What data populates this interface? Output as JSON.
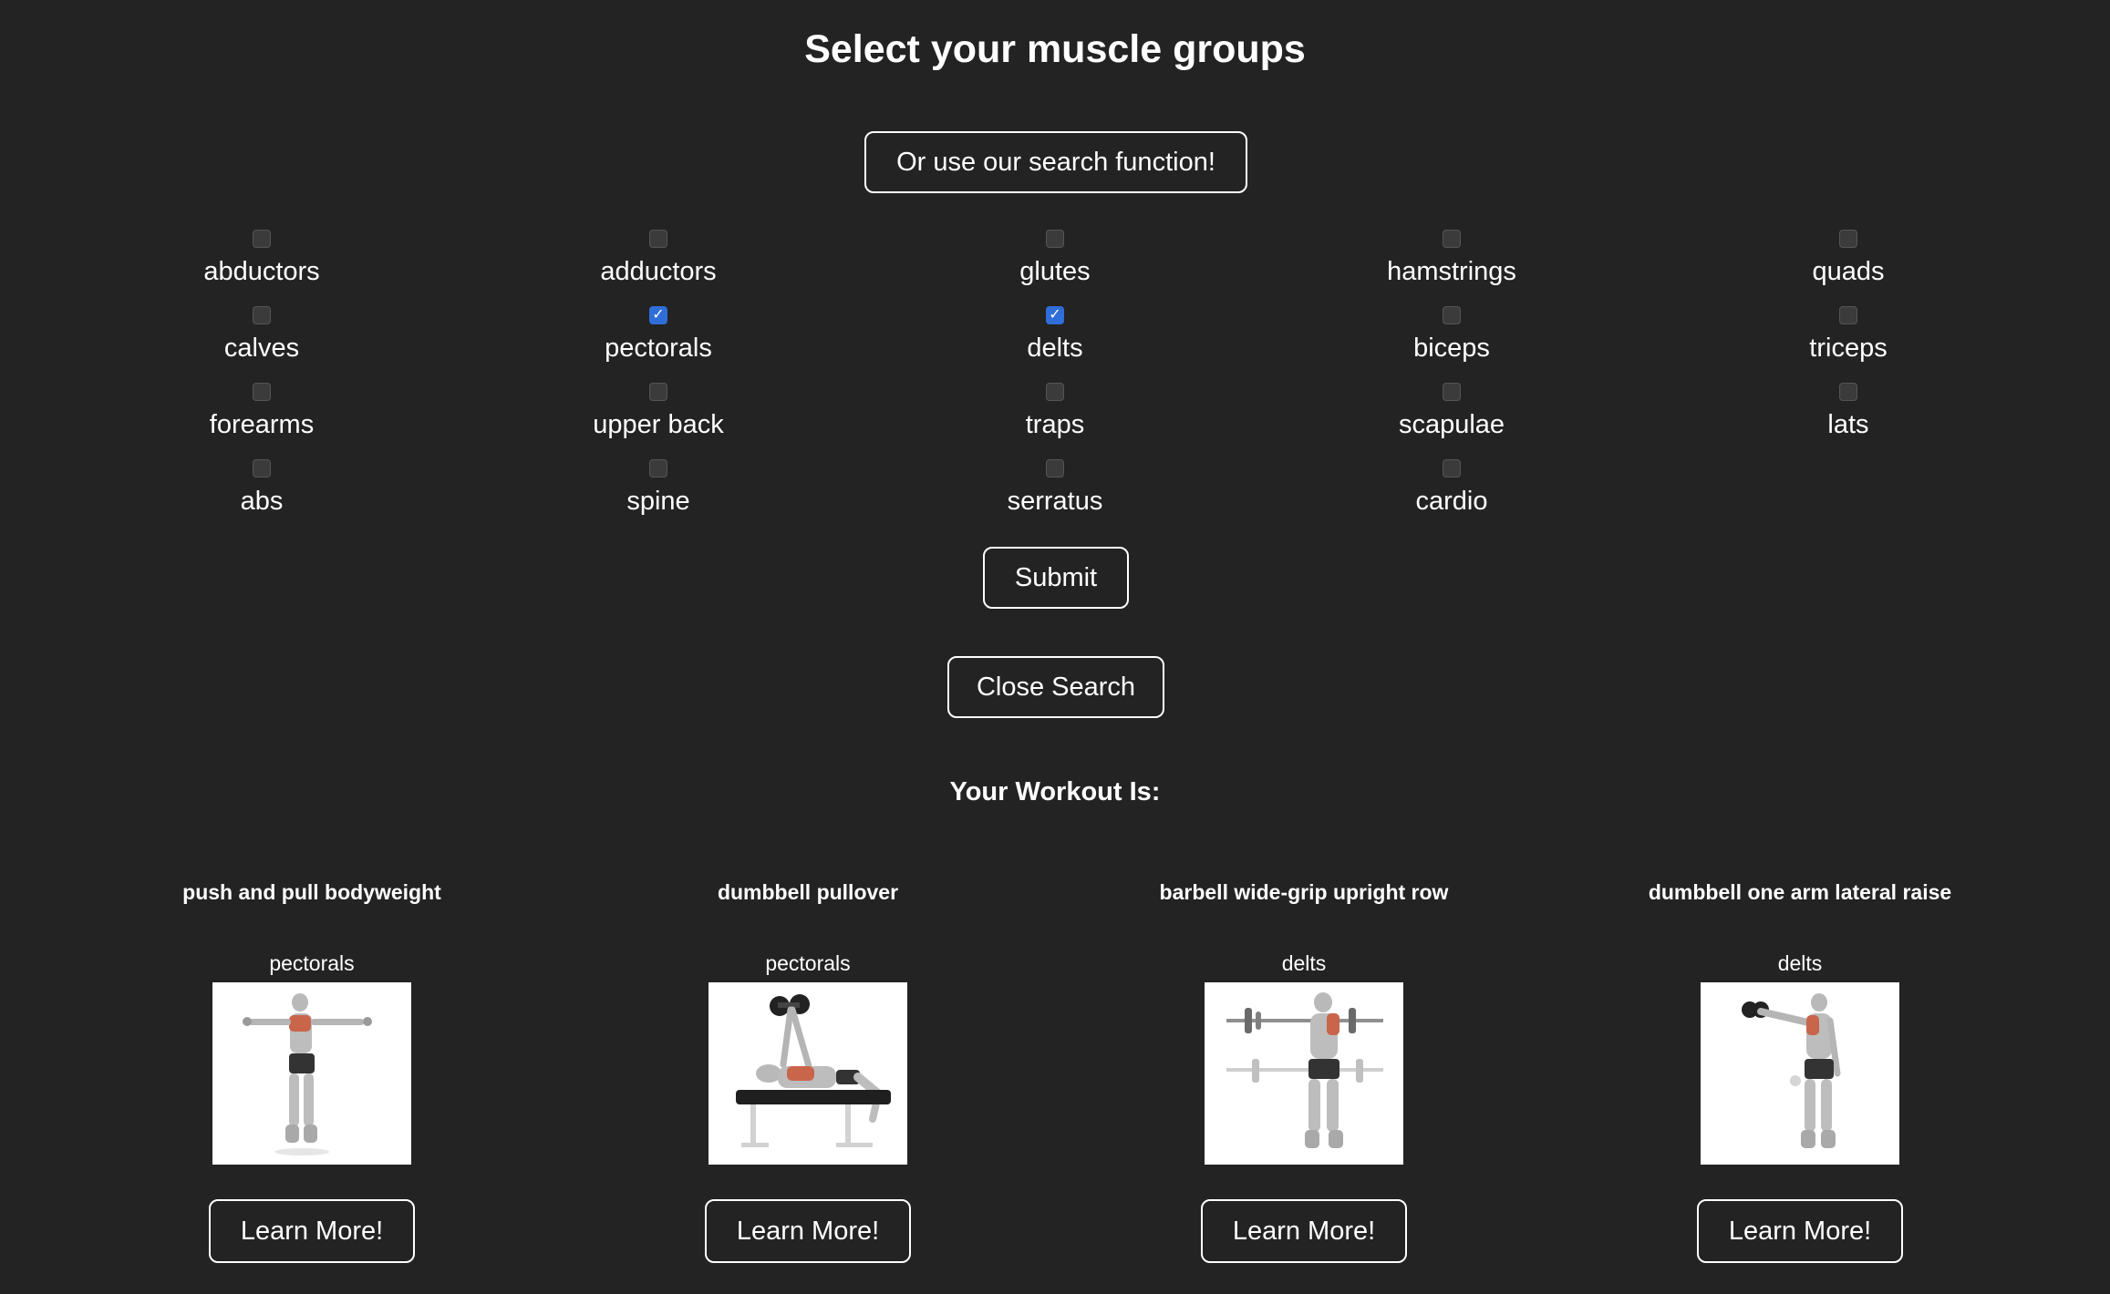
{
  "page": {
    "title": "Select your muscle groups",
    "search_button": "Or use our search function!",
    "submit_button": "Submit",
    "close_button": "Close Search",
    "workout_heading": "Your Workout Is:"
  },
  "muscles": [
    {
      "label": "abductors",
      "checked": false
    },
    {
      "label": "adductors",
      "checked": false
    },
    {
      "label": "glutes",
      "checked": false
    },
    {
      "label": "hamstrings",
      "checked": false
    },
    {
      "label": "quads",
      "checked": false
    },
    {
      "label": "calves",
      "checked": false
    },
    {
      "label": "pectorals",
      "checked": true
    },
    {
      "label": "delts",
      "checked": true
    },
    {
      "label": "biceps",
      "checked": false
    },
    {
      "label": "triceps",
      "checked": false
    },
    {
      "label": "forearms",
      "checked": false
    },
    {
      "label": "upper back",
      "checked": false
    },
    {
      "label": "traps",
      "checked": false
    },
    {
      "label": "scapulae",
      "checked": false
    },
    {
      "label": "lats",
      "checked": false
    },
    {
      "label": "abs",
      "checked": false
    },
    {
      "label": "spine",
      "checked": false
    },
    {
      "label": "serratus",
      "checked": false
    },
    {
      "label": "cardio",
      "checked": false
    }
  ],
  "workout": [
    {
      "title": "push and pull bodyweight",
      "muscle": "pectorals",
      "button": "Learn More!"
    },
    {
      "title": "dumbbell pullover",
      "muscle": "pectorals",
      "button": "Learn More!"
    },
    {
      "title": "barbell wide-grip upright row",
      "muscle": "delts",
      "button": "Learn More!"
    },
    {
      "title": "dumbbell one arm lateral raise",
      "muscle": "delts",
      "button": "Learn More!"
    }
  ],
  "colors": {
    "background": "#232323",
    "checkbox_checked": "#2f6ed8",
    "highlight_muscle": "#c8654a"
  }
}
